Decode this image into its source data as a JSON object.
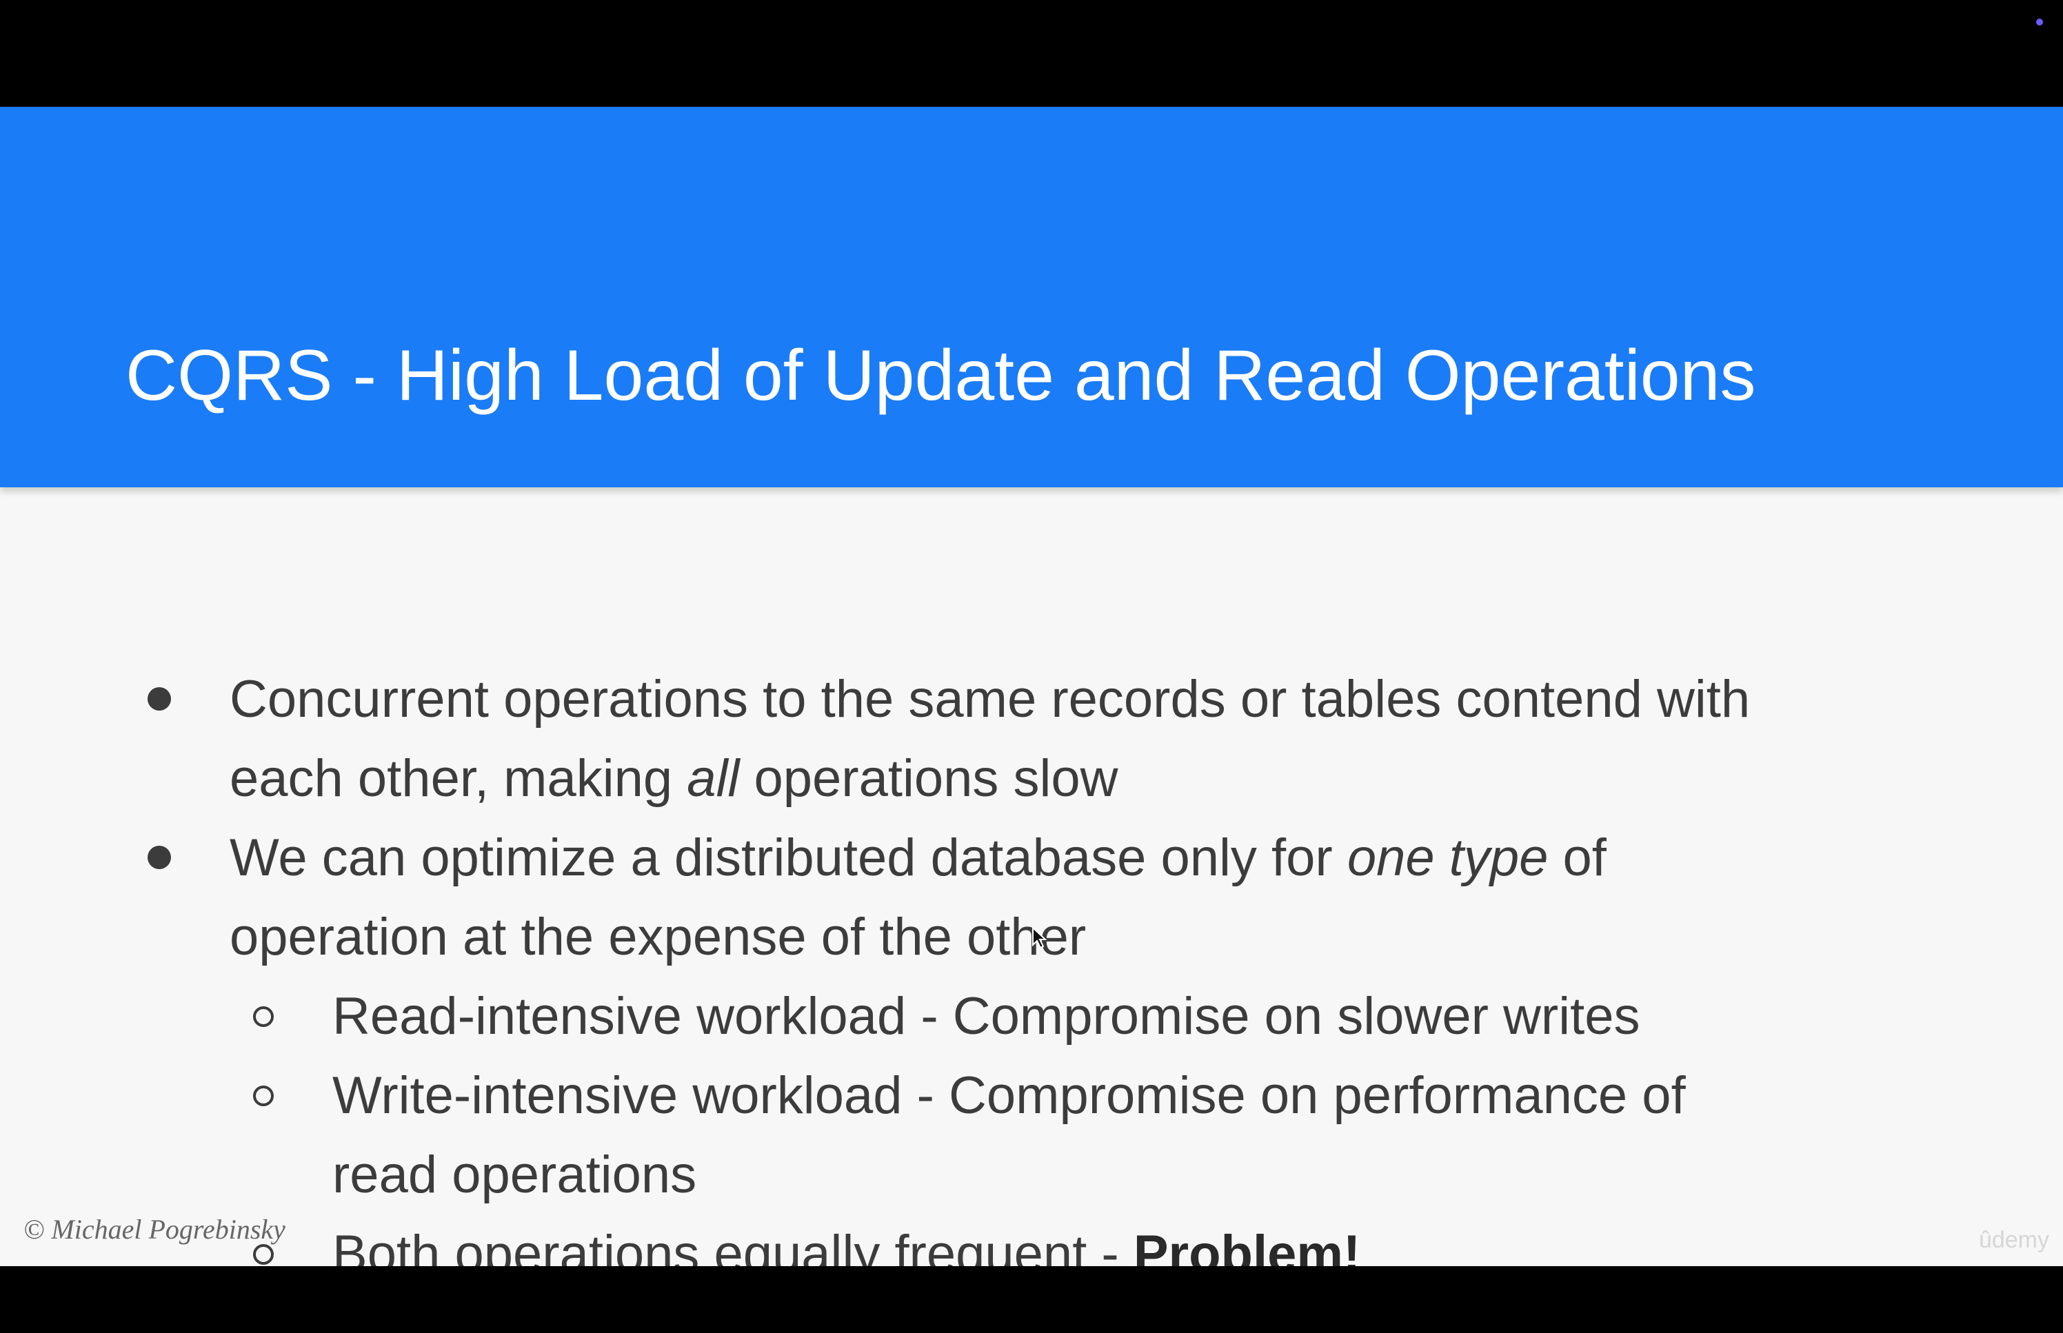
{
  "slide": {
    "title": "CQRS - High Load of Update and Read Operations",
    "bullets": [
      {
        "line1": "Concurrent operations to the same records or tables contend with",
        "line2_a": "each other, making ",
        "line2_em": "all",
        "line2_b": " operations slow"
      },
      {
        "line1_a": "We can optimize a distributed database only for ",
        "line1_em": "one type",
        "line1_b": " of",
        "line2": "operation at the expense of the other"
      }
    ],
    "sub_bullets": [
      {
        "text": "Read-intensive workload - Compromise on slower writes"
      },
      {
        "line1": "Write-intensive workload - Compromise on performance of",
        "line2": "read operations"
      },
      {
        "text": "Both operations equally frequent - ",
        "strong": "Problem!"
      }
    ],
    "credit": "© Michael Pogrebinsky",
    "watermark": "ûdemy"
  }
}
